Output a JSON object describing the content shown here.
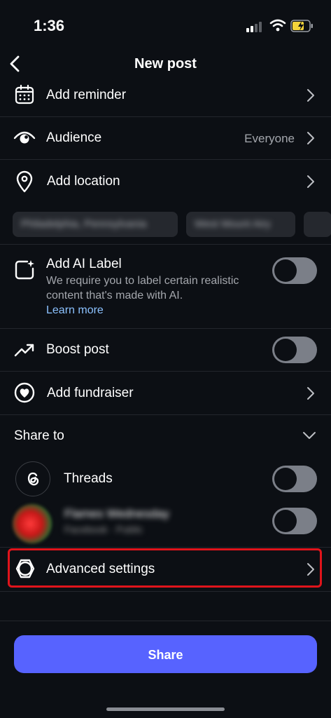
{
  "status_bar": {
    "time": "1:36"
  },
  "header": {
    "title": "New post"
  },
  "rows": {
    "reminder": {
      "label": "Add reminder"
    },
    "audience": {
      "label": "Audience",
      "value": "Everyone"
    },
    "location": {
      "label": "Add location"
    },
    "location_suggestions": [
      "Philadelphia, Pennsylvania",
      "West Mount Airy"
    ],
    "ai_label": {
      "label": "Add AI Label",
      "description": "We require you to label certain realistic content that's made with AI.",
      "link": "Learn more",
      "enabled": false
    },
    "boost": {
      "label": "Boost post",
      "enabled": false
    },
    "fundraiser": {
      "label": "Add fundraiser"
    }
  },
  "share_to": {
    "label": "Share to",
    "accounts": [
      {
        "name": "Threads",
        "enabled": false
      },
      {
        "name": "Flames Wednesday",
        "sub": "Facebook · Public",
        "enabled": false
      }
    ]
  },
  "advanced": {
    "label": "Advanced settings"
  },
  "footer": {
    "share_label": "Share"
  },
  "colors": {
    "accent": "#5763ff",
    "highlight": "#e0141b",
    "link": "#8cc2ff",
    "background": "#0c0f14"
  }
}
